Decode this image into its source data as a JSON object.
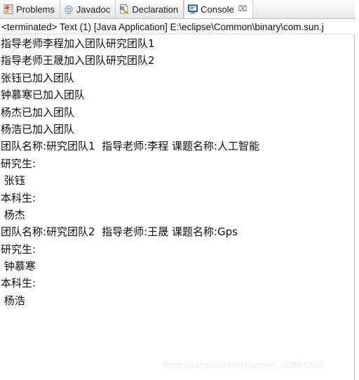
{
  "window": {
    "accent_color": "#2b5f9e",
    "background": "#ffffff",
    "border_color": "#b8bcc0"
  },
  "tabs": [
    {
      "label": "Problems",
      "icon": "problems-icon",
      "active": false,
      "closable": false
    },
    {
      "label": "Javadoc",
      "icon": "javadoc-icon",
      "active": false,
      "closable": false
    },
    {
      "label": "Declaration",
      "icon": "declaration-icon",
      "active": false,
      "closable": false
    },
    {
      "label": "Console",
      "icon": "console-icon",
      "active": true,
      "closable": true,
      "close_glyph": "⌧"
    }
  ],
  "process_line": {
    "text": "<terminated> Text (1) [Java Application] E:\\eclipse\\Common\\binary\\com.sun.j"
  },
  "console": {
    "lines": [
      {
        "text": "指导老师李程加入团队研究团队1"
      },
      {
        "text": "指导老师王晟加入团队研究团队2"
      },
      {
        "text": "张钰已加入团队"
      },
      {
        "text": "钟慕寒已加入团队"
      },
      {
        "text": "杨杰已加入团队"
      },
      {
        "text": "杨浩已加入团队"
      },
      {
        "text": "团队名称:研究团队1  指导老师:李程 课题名称:人工智能"
      },
      {
        "text": "研究生:"
      },
      {
        "text": " 张钰"
      },
      {
        "text": "本科生:"
      },
      {
        "text": " 杨杰"
      },
      {
        "text": "团队名称:研究团队2  指导老师:王晟 课题名称:Gps"
      },
      {
        "text": "研究生:"
      },
      {
        "text": " 钟慕寒"
      },
      {
        "text": "本科生:"
      },
      {
        "text": " 杨浩"
      }
    ]
  },
  "watermark": {
    "text": "https://blog.csdn.net/weixin_45984250"
  }
}
